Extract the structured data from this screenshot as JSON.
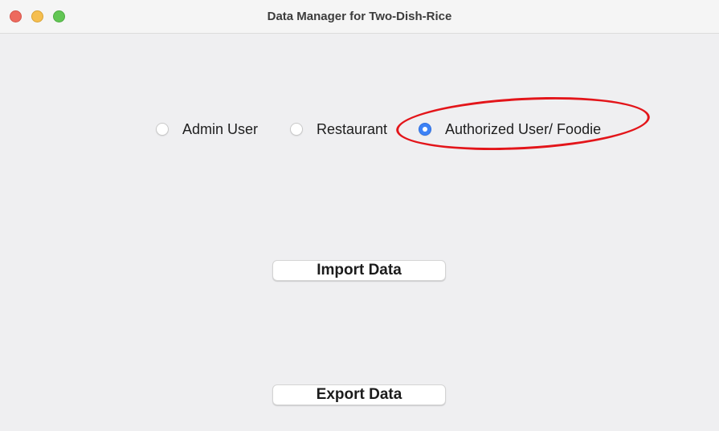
{
  "window": {
    "title": "Data Manager for Two-Dish-Rice"
  },
  "user_type": {
    "options": [
      {
        "label": "Admin User",
        "checked": false
      },
      {
        "label": "Restaurant",
        "checked": false
      },
      {
        "label": "Authorized User/ Foodie",
        "checked": true
      }
    ]
  },
  "actions": {
    "import_label": "Import Data",
    "export_label": "Export Data"
  },
  "colors": {
    "accent": "#3d82f6",
    "annotation": "#e3151a",
    "close": "#ed6a5e",
    "minimize": "#f5be4f",
    "zoom": "#62c654"
  },
  "icons": {
    "close": "close-window-icon",
    "minimize": "minimize-window-icon",
    "zoom": "zoom-window-icon"
  }
}
